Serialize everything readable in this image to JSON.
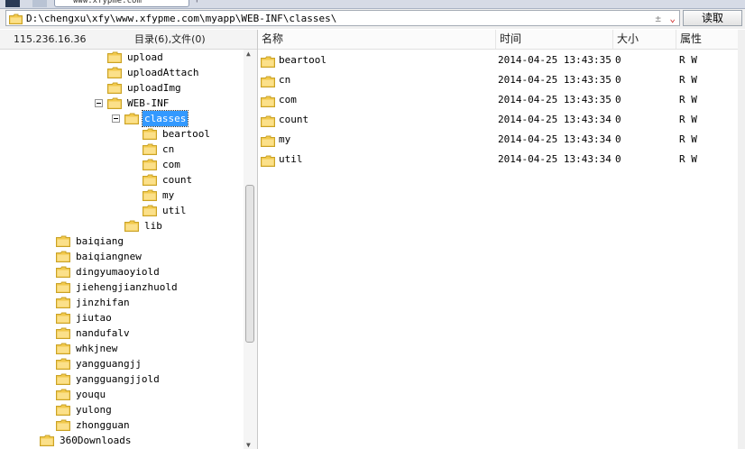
{
  "address_bar": {
    "path": "D:\\chengxu\\xfy\\www.xfypme.com\\myapp\\WEB-INF\\classes\\",
    "read_button": "读取"
  },
  "tab": {
    "title": "www.xfypme.com"
  },
  "left_header": {
    "ip": "115.236.16.36",
    "summary": "目录(6),文件(0)"
  },
  "tree": [
    {
      "label": "upload",
      "depth": 2
    },
    {
      "label": "uploadAttach",
      "depth": 2
    },
    {
      "label": "uploadImg",
      "depth": 2
    },
    {
      "label": "WEB-INF",
      "depth": 2,
      "expanded": true
    },
    {
      "label": "classes",
      "depth": 3,
      "expanded": true,
      "selected": true
    },
    {
      "label": "beartool",
      "depth": 4
    },
    {
      "label": "cn",
      "depth": 4
    },
    {
      "label": "com",
      "depth": 4
    },
    {
      "label": "count",
      "depth": 4
    },
    {
      "label": "my",
      "depth": 4
    },
    {
      "label": "util",
      "depth": 4
    },
    {
      "label": "lib",
      "depth": 3
    },
    {
      "label": "baiqiang",
      "depth": 1
    },
    {
      "label": "baiqiangnew",
      "depth": 1
    },
    {
      "label": "dingyumaoyiold",
      "depth": 1
    },
    {
      "label": "jiehengjianzhuold",
      "depth": 1
    },
    {
      "label": "jinzhifan",
      "depth": 1
    },
    {
      "label": "jiutao",
      "depth": 1
    },
    {
      "label": "nandufalv",
      "depth": 1
    },
    {
      "label": "whkjnew",
      "depth": 1
    },
    {
      "label": "yangguangjj",
      "depth": 1
    },
    {
      "label": "yangguangjjold",
      "depth": 1
    },
    {
      "label": "youqu",
      "depth": 1
    },
    {
      "label": "yulong",
      "depth": 1
    },
    {
      "label": "zhongguan",
      "depth": 1
    },
    {
      "label": "360Downloads",
      "depth": 0
    }
  ],
  "file_list": {
    "columns": [
      "名称",
      "时间",
      "大小",
      "属性"
    ],
    "rows": [
      {
        "name": "beartool",
        "time": "2014-04-25 13:43:35",
        "size": "0",
        "attr": "R W"
      },
      {
        "name": "cn",
        "time": "2014-04-25 13:43:35",
        "size": "0",
        "attr": "R W"
      },
      {
        "name": "com",
        "time": "2014-04-25 13:43:35",
        "size": "0",
        "attr": "R W"
      },
      {
        "name": "count",
        "time": "2014-04-25 13:43:34",
        "size": "0",
        "attr": "R W"
      },
      {
        "name": "my",
        "time": "2014-04-25 13:43:34",
        "size": "0",
        "attr": "R W"
      },
      {
        "name": "util",
        "time": "2014-04-25 13:43:34",
        "size": "0",
        "attr": "R W"
      }
    ]
  },
  "colors": {
    "folder": "#f2c94c",
    "folder_edge": "#c9a227",
    "selection": "#3399ff",
    "dropdown": "#c22222"
  }
}
